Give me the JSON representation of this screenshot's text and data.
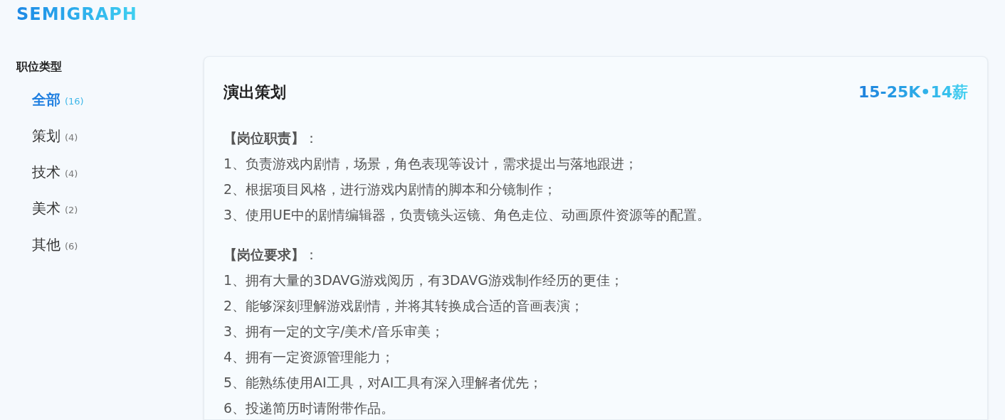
{
  "logo": "SEMIGRAPH",
  "sidebar": {
    "title": "职位类型",
    "items": [
      {
        "label": "全部",
        "count": "(16)",
        "selected": true
      },
      {
        "label": "策划",
        "count": "(4)",
        "selected": false
      },
      {
        "label": "技术",
        "count": "(4)",
        "selected": false
      },
      {
        "label": "美术",
        "count": "(2)",
        "selected": false
      },
      {
        "label": "其他",
        "count": "(6)",
        "selected": false
      }
    ]
  },
  "job": {
    "title": "演出策划",
    "salary": "15-25K•14薪",
    "sections": [
      {
        "heading": "**【岗位职责】**：",
        "lines": [
          "1、负责游戏内剧情，场景，角色表现等设计，需求提出与落地跟进；",
          "2、根据项目风格，进行游戏内剧情的脚本和分镜制作；",
          "3、使用UE中的剧情编辑器，负责镜头运镜、角色走位、动画原件资源等的配置。"
        ]
      },
      {
        "heading": "**【岗位要求】**：",
        "lines": [
          "1、拥有大量的3DAVG游戏阅历，有3DAVG游戏制作经历的更佳；",
          "2、能够深刻理解游戏剧情，并将其转换成合适的音画表演；",
          "3、拥有一定的文字/美术/音乐审美；",
          "4、拥有一定资源管理能力；",
          "5、能熟练使用AI工具，对AI工具有深入理解者优先；",
          "6、投递简历时请附带作品。"
        ]
      }
    ]
  }
}
